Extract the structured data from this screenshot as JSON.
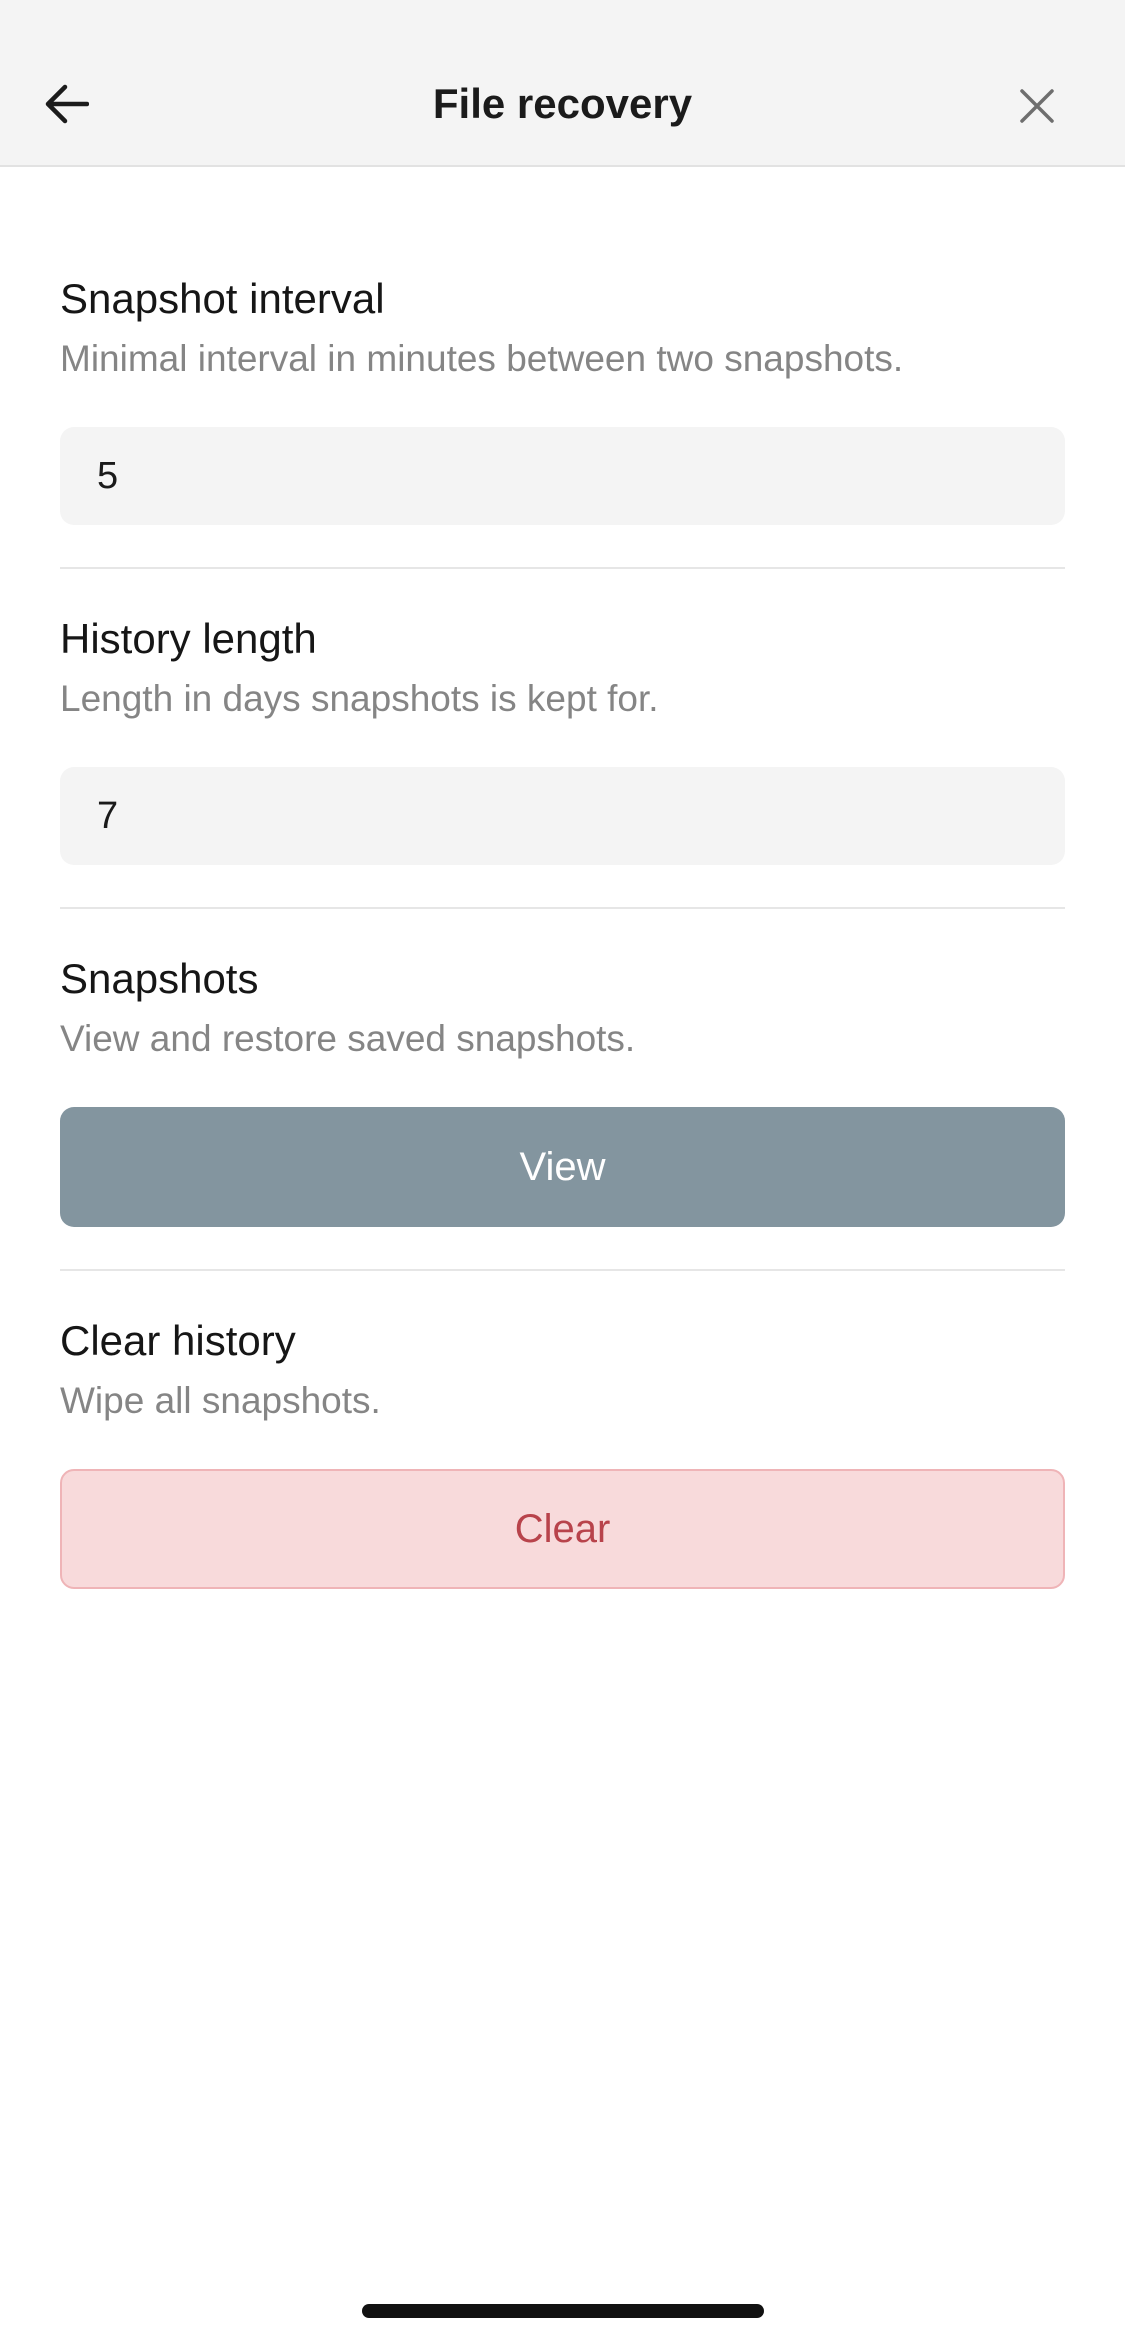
{
  "header": {
    "title": "File recovery",
    "back_icon": "arrow-left-icon",
    "close_icon": "close-icon"
  },
  "sections": {
    "snapshot_interval": {
      "title": "Snapshot interval",
      "description": "Minimal interval in minutes between two snapshots.",
      "value": "5"
    },
    "history_length": {
      "title": "History length",
      "description": "Length in days snapshots is kept for.",
      "value": "7"
    },
    "snapshots": {
      "title": "Snapshots",
      "description": "View and restore saved snapshots.",
      "button_label": "View"
    },
    "clear_history": {
      "title": "Clear history",
      "description": "Wipe all snapshots.",
      "button_label": "Clear"
    }
  },
  "colors": {
    "header_bg": "#f4f4f4",
    "view_button_bg": "#83959f",
    "clear_button_bg": "#f8dadb",
    "clear_button_text": "#b8434b"
  }
}
